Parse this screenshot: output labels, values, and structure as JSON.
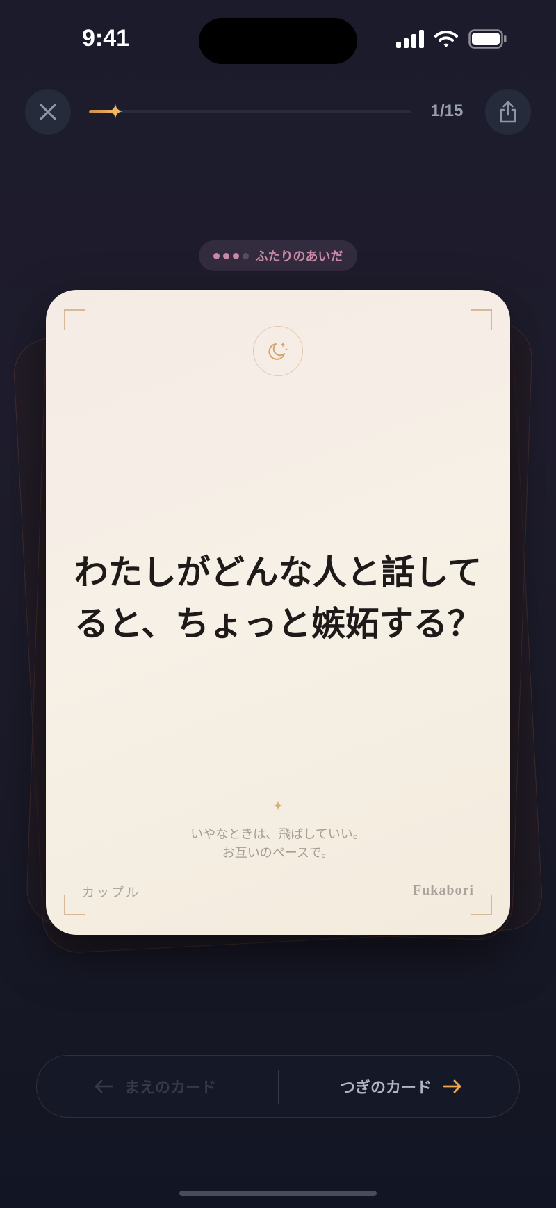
{
  "status_bar": {
    "time": "9:41"
  },
  "top_bar": {
    "close_icon": "close-icon",
    "share_icon": "share-icon",
    "progress": {
      "current": 1,
      "total": 15,
      "label": "1/15"
    }
  },
  "category": {
    "label": "ふたりのあいだ",
    "level": {
      "filled": 3,
      "total": 4
    },
    "color": "#c98aa8"
  },
  "card": {
    "icon": "moon-stars-icon",
    "question_lines": [
      "わたしがどんな人と話して",
      "ると、ちょっと嫉妬する？"
    ],
    "note_lines": [
      "いやなときは、飛ばしていい。",
      "お互いのペースで。"
    ],
    "deck_name": "カップル",
    "brand": "Fukabori",
    "accent_color": "#d8b996"
  },
  "navigation": {
    "prev_label": "まえのカード",
    "next_label": "つぎのカード",
    "next_arrow_color": "#f0a64c"
  }
}
